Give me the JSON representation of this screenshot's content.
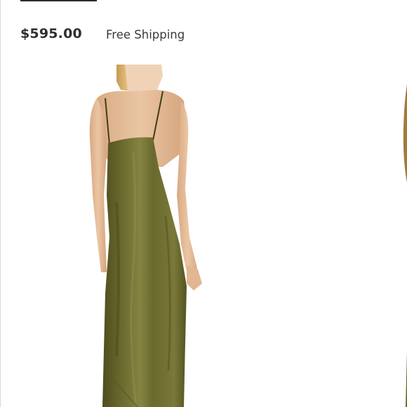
{
  "listing": {
    "price": "$595.00",
    "shipping": "Free Shipping"
  },
  "photo": {
    "subject": "olive satin slip dress, back view",
    "dress_color": "#6b6a2e",
    "skin_color": "#e7c19e",
    "hair_color": "#d9b672"
  }
}
